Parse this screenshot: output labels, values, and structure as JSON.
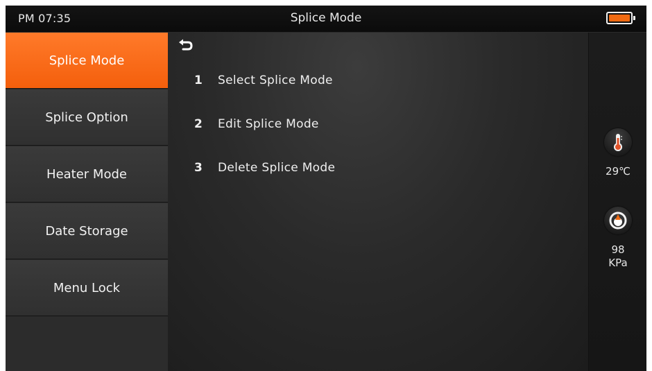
{
  "header": {
    "time": "PM 07:35",
    "title": "Splice Mode"
  },
  "sidebar": {
    "items": [
      {
        "label": "Splice Mode",
        "active": true
      },
      {
        "label": "Splice Option",
        "active": false
      },
      {
        "label": "Heater Mode",
        "active": false
      },
      {
        "label": "Date Storage",
        "active": false
      },
      {
        "label": "Menu Lock",
        "active": false
      }
    ]
  },
  "main": {
    "menu": [
      {
        "num": "1",
        "label": "Select Splice Mode"
      },
      {
        "num": "2",
        "label": "Edit Splice Mode"
      },
      {
        "num": "3",
        "label": "Delete Splice Mode"
      }
    ]
  },
  "status": {
    "temperature": "29℃",
    "pressure_value": "98",
    "pressure_unit": "KPa"
  },
  "icons": {
    "back": "back-arrow-icon",
    "battery": "battery-icon",
    "temperature": "thermometer-icon",
    "pressure": "pressure-gauge-icon"
  },
  "colors": {
    "accent": "#f45f0c",
    "battery_fill": "#f06a12"
  }
}
